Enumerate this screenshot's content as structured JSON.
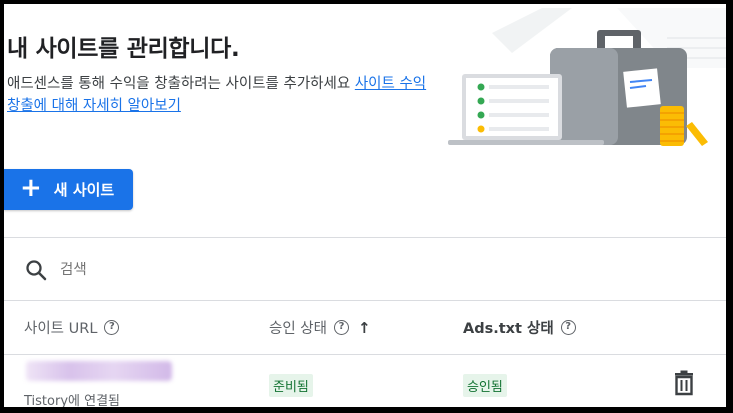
{
  "page": {
    "title": "내 사이트를 관리합니다.",
    "subtitle_text": "애드센스를 통해 수익을 창출하려는 사이트를 추가하세요 ",
    "subtitle_link": "사이트 수익 창출에 대해 자세히 알아보기"
  },
  "toolbar": {
    "new_site_icon": "+",
    "new_site_label": "새 사이트"
  },
  "search": {
    "placeholder": "검색"
  },
  "table": {
    "columns": [
      {
        "label": "사이트 URL",
        "help": "?"
      },
      {
        "label": "승인 상태",
        "help": "?",
        "sort": "↑"
      },
      {
        "label": "Ads.txt 상태",
        "help": "?"
      }
    ],
    "rows": [
      {
        "connection": "Tistory에 연결됨",
        "approval_status": "준비됨",
        "ads_txt_status": "승인됨"
      }
    ]
  },
  "icons": {
    "search": "search-icon",
    "help": "help-icon",
    "sort": "arrow-up-icon",
    "delete": "trash-icon",
    "hero": "briefcase-illustration"
  },
  "colors": {
    "accent": "#1a73e8",
    "badge_bg": "#e6f4ea",
    "badge_text": "#137333"
  }
}
